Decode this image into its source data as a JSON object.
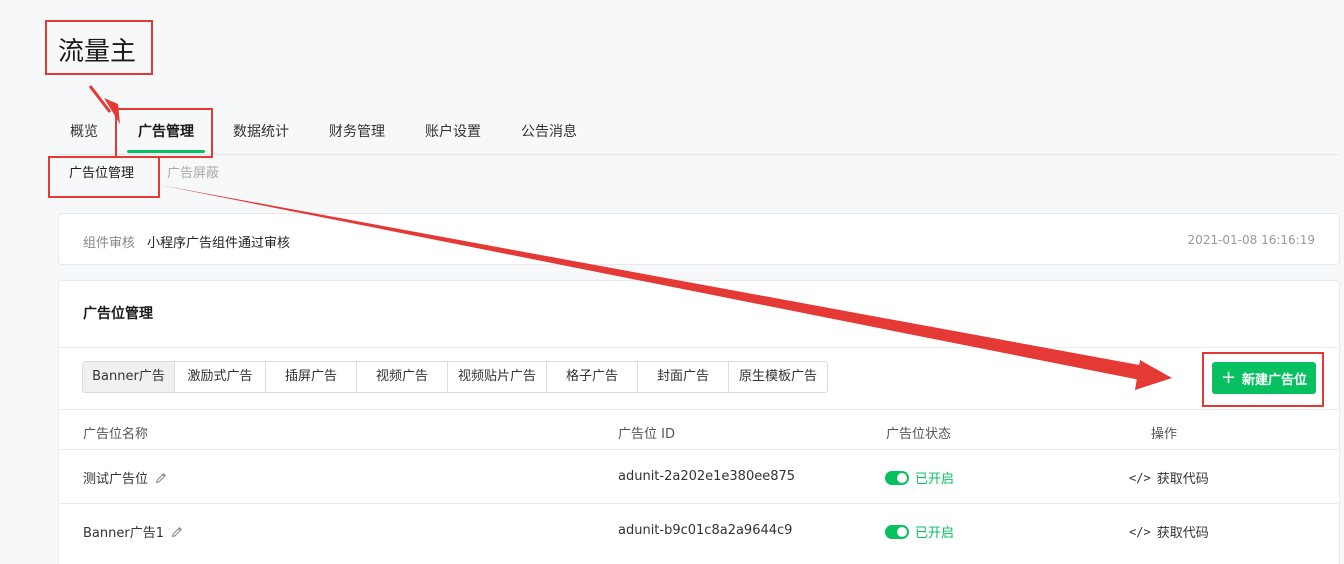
{
  "page_title": "流量主",
  "top_tabs": [
    {
      "label": "概览",
      "active": false
    },
    {
      "label": "广告管理",
      "active": true
    },
    {
      "label": "数据统计",
      "active": false
    },
    {
      "label": "财务管理",
      "active": false
    },
    {
      "label": "账户设置",
      "active": false
    },
    {
      "label": "公告消息",
      "active": false
    }
  ],
  "sub_tabs": [
    {
      "label": "广告位管理",
      "active": true
    },
    {
      "label": "广告屏蔽",
      "active": false
    }
  ],
  "notice": {
    "label": "组件审核",
    "text": "小程序广告组件通过审核",
    "time": "2021-01-08 16:16:19"
  },
  "ad_management": {
    "title": "广告位管理",
    "types": [
      {
        "label": "Banner广告",
        "active": true
      },
      {
        "label": "激励式广告",
        "active": false
      },
      {
        "label": "插屏广告",
        "active": false
      },
      {
        "label": "视频广告",
        "active": false
      },
      {
        "label": "视频贴片广告",
        "active": false
      },
      {
        "label": "格子广告",
        "active": false
      },
      {
        "label": "封面广告",
        "active": false
      },
      {
        "label": "原生模板广告",
        "active": false
      }
    ],
    "new_button": {
      "icon": "+",
      "label": "新建广告位"
    },
    "table": {
      "headers": [
        "广告位名称",
        "广告位 ID",
        "广告位状态",
        "操作"
      ],
      "rows": [
        {
          "name": "测试广告位",
          "id": "adunit-2a202e1e380ee875",
          "status": "已开启",
          "action_icon": "</>",
          "action": "获取代码"
        },
        {
          "name": "Banner广告1",
          "id": "adunit-b9c01c8a2a9644c9",
          "status": "已开启",
          "action_icon": "</>",
          "action": "获取代码"
        }
      ]
    }
  },
  "colors": {
    "accent": "#07c160",
    "annotation": "#e53935"
  }
}
